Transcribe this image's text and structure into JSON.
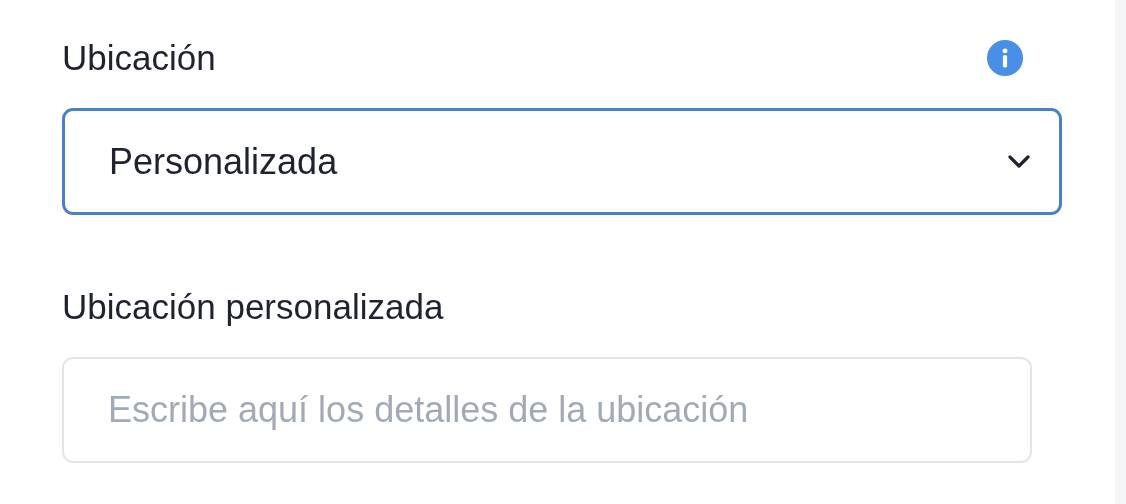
{
  "fields": [
    {
      "kind": "select",
      "label": "Ubicación",
      "info": true,
      "value": "Personalizada",
      "focused": true
    },
    {
      "kind": "text",
      "label": "Ubicación personalizada",
      "placeholder": "Escribe aquí los detalles de la ubicación"
    }
  ]
}
